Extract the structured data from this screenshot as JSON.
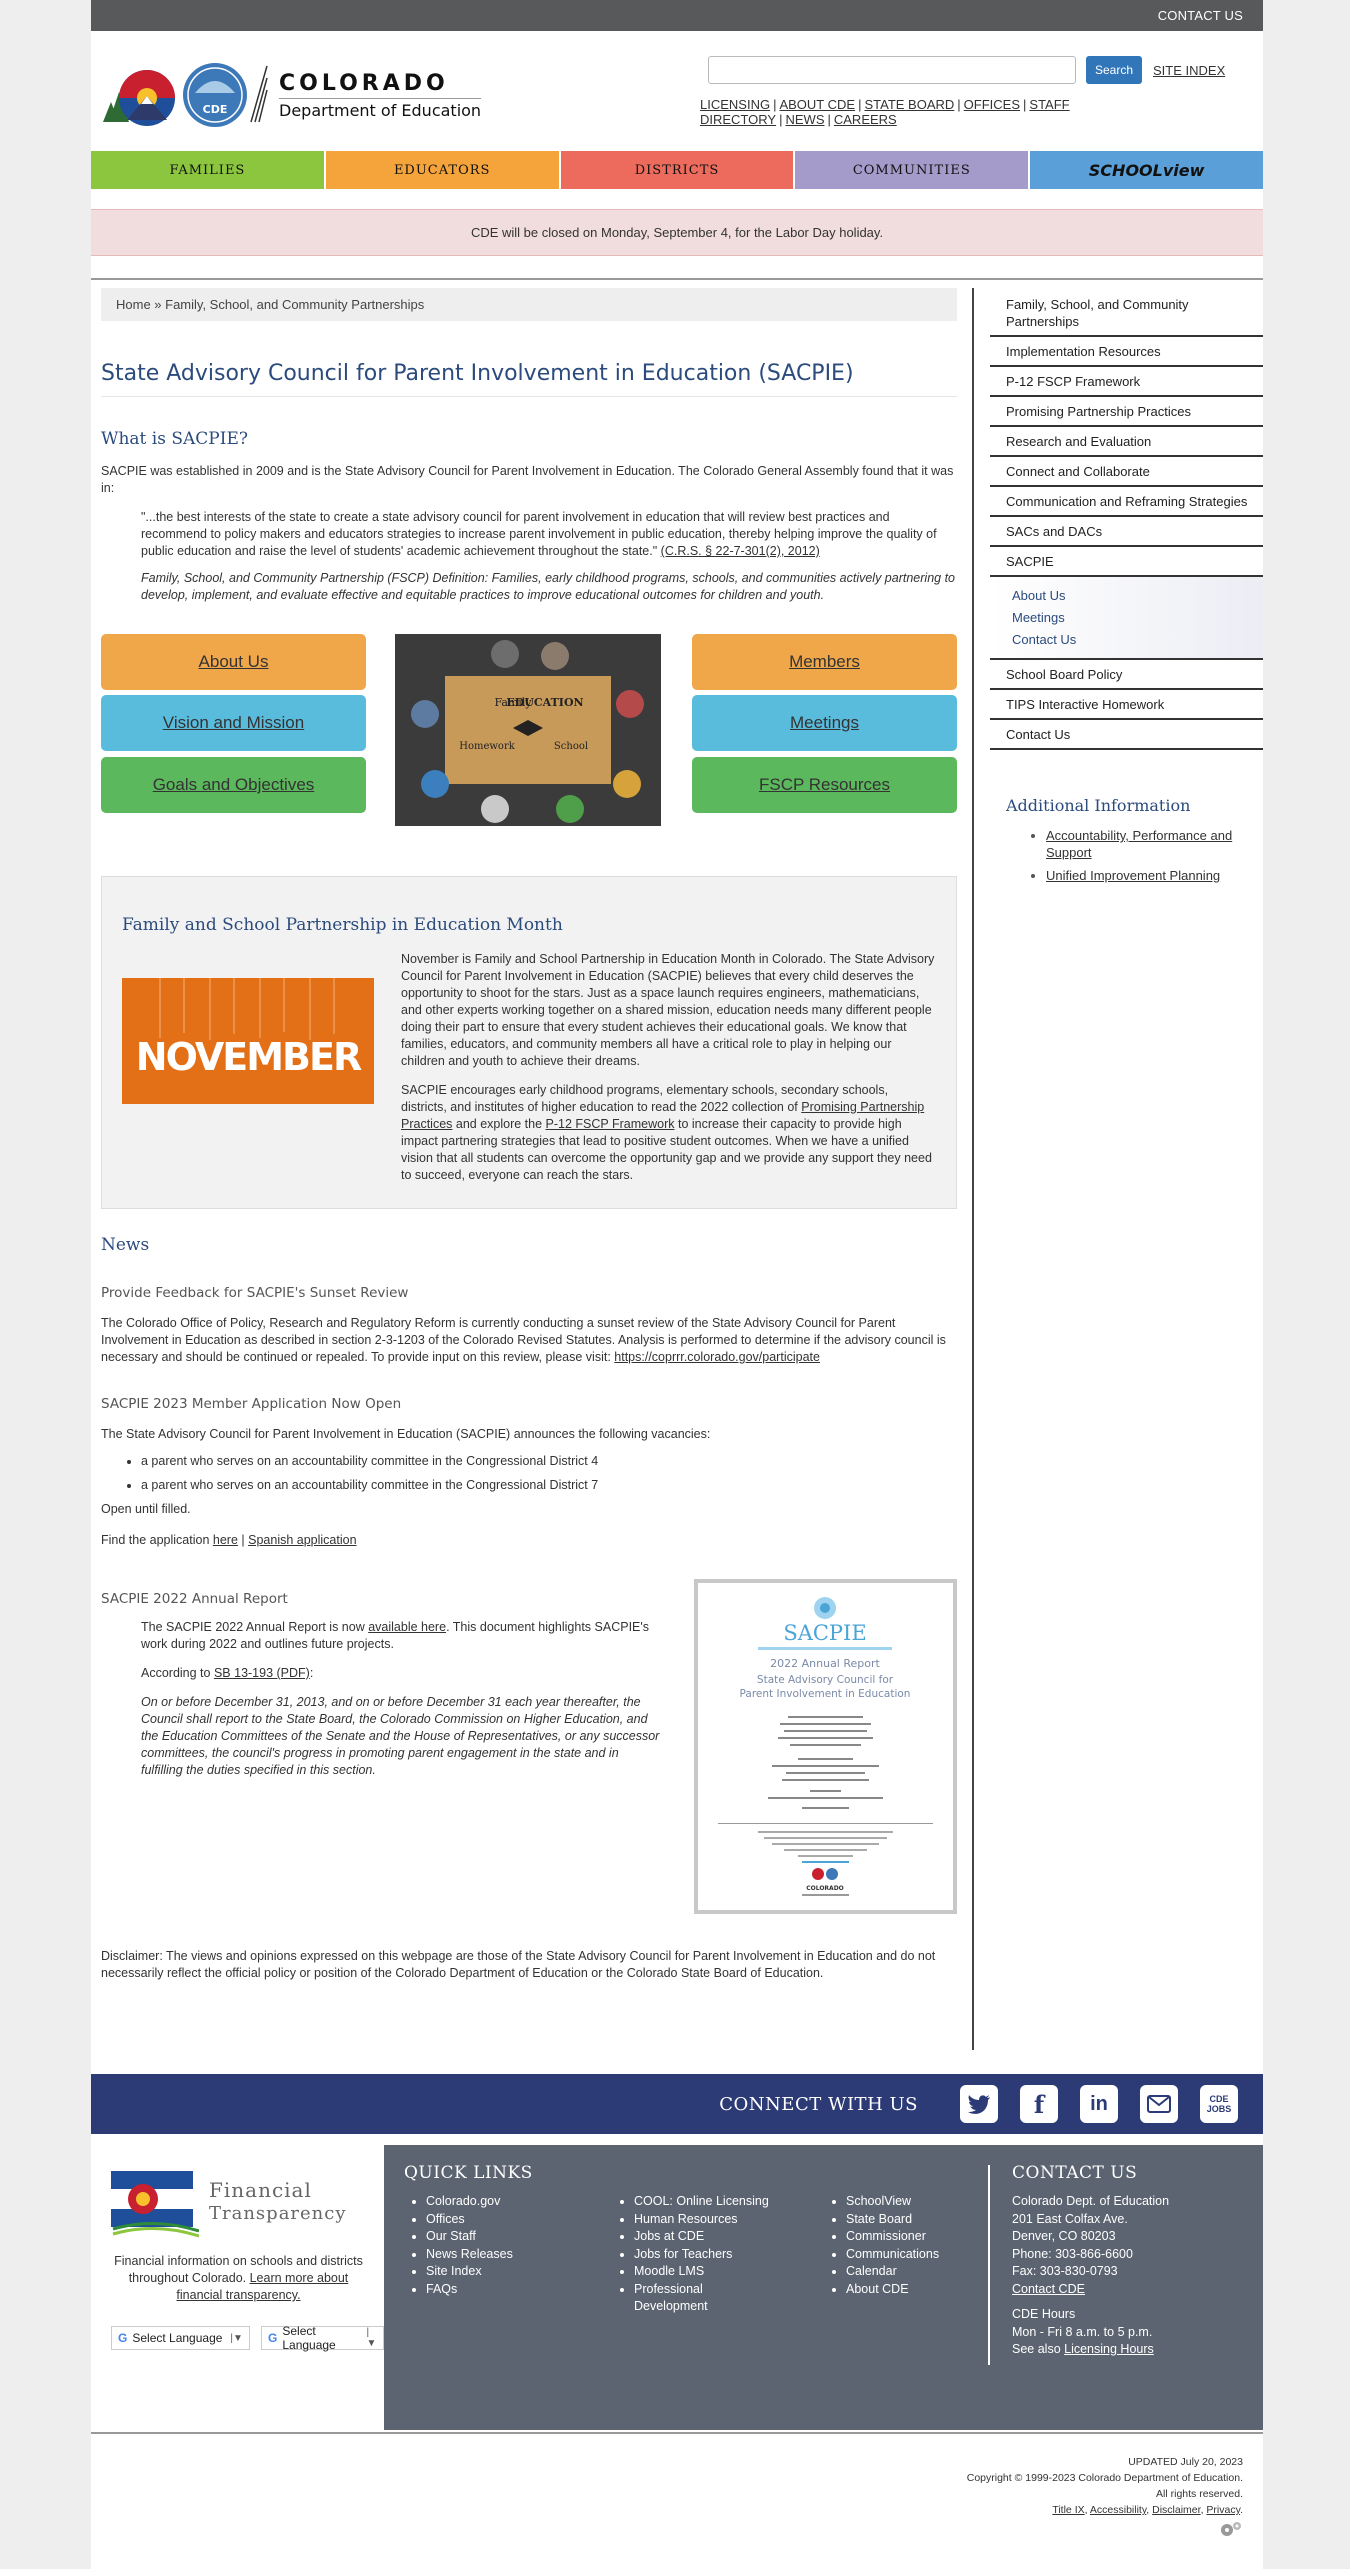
{
  "topbar": {
    "contact_us": "CONTACT US"
  },
  "header": {
    "logo_line1": "COLORADO",
    "logo_line2": "Department of Education",
    "logo_badge": "CDE",
    "search_placeholder": "",
    "search_button": "Search",
    "site_index": "SITE INDEX",
    "links": [
      "LICENSING",
      "ABOUT CDE",
      "STATE BOARD",
      "OFFICES",
      "STAFF DIRECTORY",
      "NEWS",
      "CAREERS"
    ]
  },
  "nav": {
    "items": [
      {
        "label": "FAMILIES",
        "color": "#8cc63f"
      },
      {
        "label": "EDUCATORS",
        "color": "#f5a33b"
      },
      {
        "label": "DISTRICTS",
        "color": "#ec6b5c"
      },
      {
        "label": "COMMUNITIES",
        "color": "#a59bcb"
      },
      {
        "label": "SCHOOLview",
        "color": "#5a9fd8"
      }
    ]
  },
  "alert": "CDE will be closed on Monday, September 4, for the Labor Day holiday.",
  "breadcrumb": "Home » Family, School, and Community Partnerships",
  "page_title": "State Advisory Council for Parent Involvement in Education (SACPIE)",
  "what": {
    "heading": "What is SACPIE?",
    "intro": "SACPIE was established in 2009 and is the State Advisory Council for Parent Involvement in Education. The Colorado General Assembly found that it was in:",
    "quote": "\"...the best interests of the state to create a state advisory council for parent involvement in education that will review best practices and recommend to policy makers and educators strategies to increase parent involvement in public education, thereby helping improve the quality of public education and raise the level of students' academic achievement throughout the state.\"",
    "quote_cite": "(C.R.S. § 22-7-301(2), 2012)",
    "definition": "Family, School, and Community Partnership (FSCP) Definition: Families, early childhood programs, schools, and communities actively partnering to develop, implement, and evaluate effective and equitable practices to improve educational outcomes for children and youth."
  },
  "buttons": {
    "about": "About Us",
    "vision": "Vision and Mission",
    "goals": "Goals and Objectives",
    "members": "Members",
    "meetings": "Meetings",
    "resources": "FSCP Resources"
  },
  "photo_words": {
    "w1": "Family",
    "w2": "EDUCATION",
    "w3": "Homework",
    "w4": "School"
  },
  "fscp": {
    "heading": "Family and School Partnership in Education Month",
    "banner_text": "NOVEMBER",
    "p1": "November is Family and School Partnership in Education Month in Colorado. The State Advisory Council for Parent Involvement in Education (SACPIE) believes that every child deserves the opportunity to shoot for the stars. Just as a space launch requires engineers, mathematicians, and other experts working together on a shared mission, education needs many different people doing their part to ensure that every student achieves their educational goals. We know that families, educators, and community members all have a critical role to play in helping our children and youth to achieve their dreams.",
    "p2_a": "SACPIE encourages early childhood programs, elementary schools, secondary schools, districts, and institutes of higher education to read the 2022 collection of ",
    "p2_link1": "Promising Partnership Practices",
    "p2_b": " and explore the ",
    "p2_link2": "P-12 FSCP Framework",
    "p2_c": " to increase their capacity to provide high impact partnering strategies that lead to positive student outcomes. When we have a unified vision that all students can overcome the opportunity gap and we provide any support they need to succeed, everyone can reach the stars."
  },
  "news": {
    "heading": "News",
    "item1_title": "Provide Feedback for SACPIE's Sunset Review",
    "item1_body": "The Colorado Office of Policy, Research and Regulatory Reform is currently conducting a sunset review of the State Advisory Council for Parent Involvement in Education as described in section 2-3-1203 of the Colorado Revised Statutes.  Analysis is performed to determine if the advisory council is necessary and should be continued or repealed.  To provide input on this review, please visit: ",
    "item1_link": "https://coprrr.colorado.gov/participate",
    "item2_title": "SACPIE 2023 Member Application Now Open",
    "item2_body": "The State Advisory Council for Parent Involvement in Education (SACPIE) announces the following vacancies:",
    "vacancies": [
      "a parent who serves on an accountability committee in the Congressional District 4",
      "a parent who serves on an accountability committee in the Congressional District 7"
    ],
    "open_until": "Open until filled.",
    "find_app": "Find the application ",
    "here": "here",
    "spanish": "Spanish application",
    "item3_title": "SACPIE 2022 Annual Report",
    "report_p1_a": "The SACPIE 2022 Annual Report is now ",
    "report_link": "available here",
    "report_p1_b": ". This document highlights SACPIE's work during 2022 and outlines future projects.",
    "according_a": "According to ",
    "according_link": "SB 13-193 (PDF)",
    "according_b": ":",
    "statute": "On or before December 31, 2013, and on or before December 31 each year thereafter, the Council shall report to the State Board, the Colorado Commission on Higher Education, and the Education Committees of the Senate and the House of Representatives, or any successor committees, the council's progress in promoting parent engagement in the state and in fulfilling the duties specified in this section."
  },
  "report_cover": {
    "title": "SACPIE",
    "year": "2022 Annual Report",
    "sub1": "State Advisory Council for",
    "sub2": "Parent Involvement in Education",
    "footer_word": "COLORADO"
  },
  "disclaimer": "Disclaimer: The views and opinions expressed on this webpage are those of the State Advisory Council for Parent Involvement in Education and do not necessarily reflect the official policy or position of the Colorado Department of Education or the Colorado State Board of Education.",
  "sidebar": {
    "items_top": [
      "Family, School, and Community Partnerships",
      "Implementation Resources",
      "P-12 FSCP Framework",
      "Promising Partnership Practices",
      "Research and Evaluation",
      "Connect and Collaborate",
      "Communication and Reframing Strategies",
      "SACs and DACs",
      "SACPIE"
    ],
    "sub_items": [
      "About Us",
      "Meetings",
      "Contact Us"
    ],
    "items_bottom": [
      "School Board Policy",
      "TIPS Interactive Homework",
      "Contact Us"
    ],
    "additional_heading": "Additional Information",
    "additional_links": [
      "Accountability, Performance and Support",
      "Unified Improvement Planning"
    ]
  },
  "connect": {
    "label": "CONNECT WITH US",
    "icons": [
      "twitter-icon",
      "facebook-icon",
      "linkedin-icon",
      "email-icon",
      "cde-jobs-icon"
    ],
    "f": "f",
    "in": "in",
    "jobs": "CDE JOBS"
  },
  "footer": {
    "ft_word1": "Financial",
    "ft_word2": "Transparency",
    "ft_desc_a": "Financial information on schools and districts throughout Colorado. ",
    "ft_desc_link": "Learn more about financial transparency.",
    "select_language": "Select Language",
    "quick_links_heading": "QUICK LINKS",
    "ql_col1": [
      "Colorado.gov",
      "Offices",
      "Our Staff",
      "News Releases",
      "Site Index",
      "FAQs"
    ],
    "ql_col2": [
      "COOL: Online Licensing",
      "Human Resources",
      "Jobs at CDE",
      "Jobs for Teachers",
      "Moodle LMS",
      "Professional Development"
    ],
    "ql_col3": [
      "SchoolView",
      "State Board",
      "Commissioner",
      "Communications",
      "Calendar",
      "About CDE"
    ],
    "contact_heading": "CONTACT US",
    "contact_lines": [
      "Colorado Dept. of Education",
      "201 East Colfax Ave.",
      "Denver, CO 80203",
      "Phone: 303-866-6600",
      "Fax: 303-830-0793"
    ],
    "contact_link": "Contact CDE",
    "hours_heading": "CDE Hours",
    "hours": "Mon - Fri 8 a.m. to 5 p.m.",
    "see_also": "See also ",
    "licensing_hours": "Licensing Hours"
  },
  "bottom": {
    "updated": "UPDATED July 20, 2023",
    "copyright": "Copyright © 1999-2023 Colorado Department of Education.",
    "rights": "All rights reserved.",
    "legal_links": [
      "Title IX",
      "Accessibility",
      "Disclaimer",
      "Privacy"
    ]
  }
}
